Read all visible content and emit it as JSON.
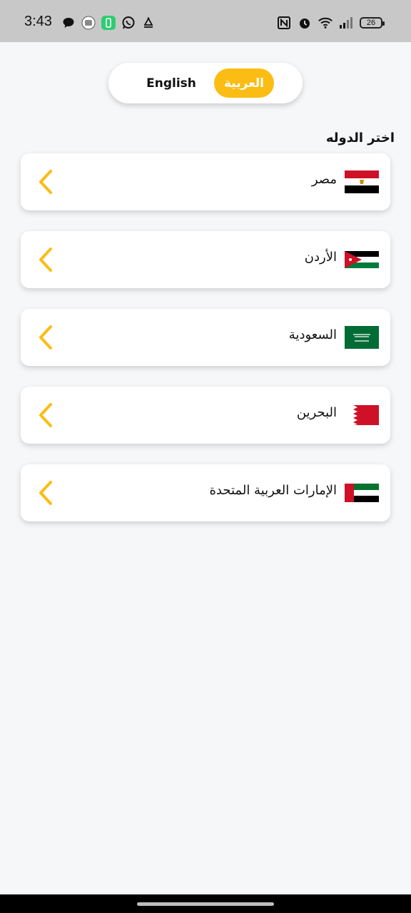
{
  "status_bar": {
    "time": "3:43",
    "battery": "26"
  },
  "language_toggle": {
    "english_label": "English",
    "arabic_label": "العربية",
    "selected": "arabic"
  },
  "section_title": "اختر الدوله",
  "countries": [
    {
      "name": "مصر",
      "flag": "egypt-flag"
    },
    {
      "name": "الأردن",
      "flag": "jordan-flag"
    },
    {
      "name": "السعودية",
      "flag": "saudi-flag"
    },
    {
      "name": "البحرين",
      "flag": "bahrain-flag"
    },
    {
      "name": "الإمارات العربية المتحدة",
      "flag": "uae-flag"
    }
  ],
  "colors": {
    "accent": "#fbbd14",
    "background": "#f6f7f9"
  }
}
